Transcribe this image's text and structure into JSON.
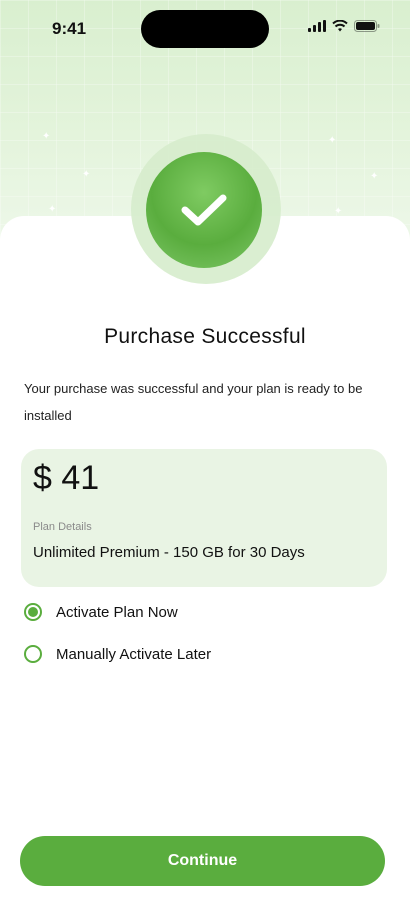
{
  "status_bar": {
    "time": "9:41",
    "icons": [
      "signal-icon",
      "wifi-icon",
      "battery-icon"
    ]
  },
  "success": {
    "icon": "check-icon",
    "title": "Purchase Successful",
    "description": "Your purchase was successful and your plan is ready to be installed"
  },
  "plan": {
    "price": "$ 41",
    "details_label": "Plan Details",
    "details_value": "Unlimited Premium - 150 GB for 30 Days"
  },
  "activation_options": [
    {
      "label": "Activate Plan Now",
      "selected": true
    },
    {
      "label": "Manually Activate Later",
      "selected": false
    }
  ],
  "actions": {
    "continue_label": "Continue"
  },
  "colors": {
    "accent": "#5aad3e",
    "hero_background": "#e4f4dc",
    "card_background": "#e9f4e4"
  }
}
